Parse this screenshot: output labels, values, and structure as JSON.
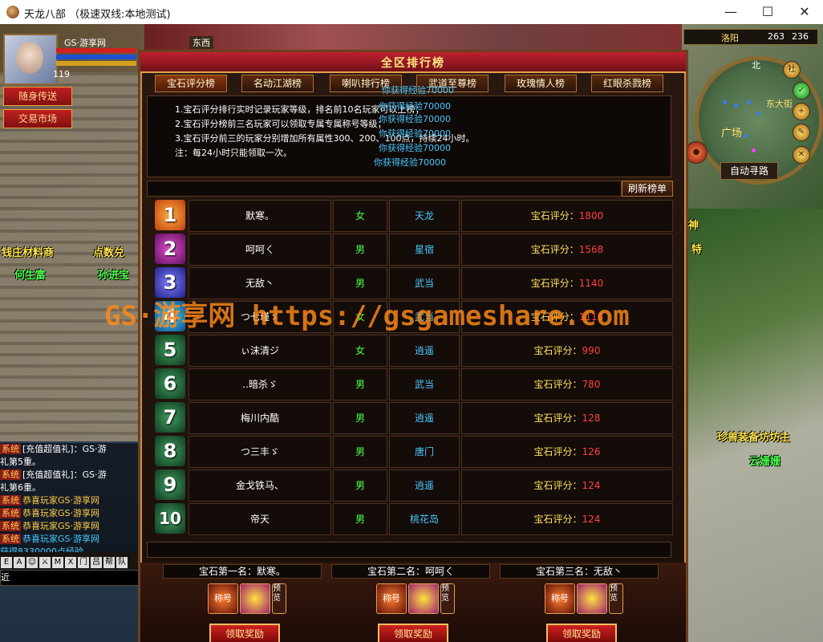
{
  "window": {
    "title": "天龙八部 （极速双线:本地测试)",
    "minimize": "—",
    "maximize": "☐",
    "close": "✕"
  },
  "character": {
    "level": "119",
    "name": "GS·游享网",
    "tab": "东西"
  },
  "quick_buttons": [
    "随身传送",
    "交易市场"
  ],
  "minimap": {
    "city": "洛阳",
    "x": "263",
    "y": "236",
    "direction": "北",
    "auto_path": "自动寻路",
    "labels": [
      "广场",
      "东大街"
    ]
  },
  "npc_labels": [
    "钱庄材料商",
    "点数兑",
    "何生富",
    "孙进宝",
    "珍兽装备坊坊主",
    "云姗姗",
    "神",
    "特"
  ],
  "panel": {
    "title": "全区排行榜",
    "tabs": [
      "宝石评分榜",
      "名动江湖榜",
      "喇叭排行榜",
      "武道至尊榜",
      "玫瑰情人榜",
      "红眼杀戮榜"
    ],
    "rules": [
      "1.宝石评分排行实时记录玩家等级，排名前10名玩家可以上榜；",
      "2.宝石评分榜前三名玩家可以领取专属专属称号等级；",
      "3.宝石评分前三的玩家分别增加所有属性300、200、100点，持续24小时。",
      "注：每24小时只能领取一次。"
    ],
    "exp_messages": [
      "你获得经验70000",
      "你获得经验70000",
      "你获得经验70000",
      "你获得经验70000",
      "你获得经验70000",
      "你获得经验70000"
    ],
    "refresh_label": "刷新榜单",
    "score_prefix": "宝石评分：",
    "rows": [
      {
        "rank": "1",
        "name": "默寒。",
        "sex": "女",
        "school": "天龙",
        "score": "1800"
      },
      {
        "rank": "2",
        "name": "呵呵ㄑ",
        "sex": "男",
        "school": "星宿",
        "score": "1568"
      },
      {
        "rank": "3",
        "name": "无敌丶",
        "sex": "男",
        "school": "武当",
        "score": "1140"
      },
      {
        "rank": "4",
        "name": "つ七瑾ゞ",
        "sex": "女",
        "school": "武当",
        "score": "1116"
      },
      {
        "rank": "5",
        "name": "ぃ沫清ジ",
        "sex": "女",
        "school": "逍遥",
        "score": "990"
      },
      {
        "rank": "6",
        "name": "‥暗杀ゞ",
        "sex": "男",
        "school": "武当",
        "score": "780"
      },
      {
        "rank": "7",
        "name": "梅川内酷",
        "sex": "男",
        "school": "逍遥",
        "score": "128"
      },
      {
        "rank": "8",
        "name": "つ三丰ゞ",
        "sex": "男",
        "school": "唐门",
        "score": "126"
      },
      {
        "rank": "9",
        "name": "金戈铁马、",
        "sex": "男",
        "school": "逍遥",
        "score": "124"
      },
      {
        "rank": "10",
        "name": "帝天",
        "sex": "男",
        "school": "桃花岛",
        "score": "124"
      }
    ],
    "rewards": [
      {
        "label": "宝石第一名：默寒。",
        "button": "领取奖励",
        "icon_text": "称号"
      },
      {
        "label": "宝石第二名：呵呵ㄑ",
        "button": "领取奖励",
        "icon_text": "称号"
      },
      {
        "label": "宝石第三名：无敌丶",
        "button": "领取奖励",
        "icon_text": "称号"
      }
    ],
    "preview": "预览"
  },
  "chat": {
    "lines": [
      {
        "tag": "系统",
        "text": "[充值超值礼]：GS·游"
      },
      {
        "tag": "",
        "text": "礼第5重。"
      },
      {
        "tag": "系统",
        "text": "[充值超值礼]：GS·游"
      },
      {
        "tag": "",
        "text": "礼第6重。"
      },
      {
        "tag": "系统",
        "text": "恭喜玩家GS·游享网"
      },
      {
        "tag": "系统",
        "text": "恭喜玩家GS·游享网"
      },
      {
        "tag": "系统",
        "text": "恭喜玩家GS·游享网"
      },
      {
        "tag": "系统",
        "text": "恭喜玩家GS·游享网"
      }
    ],
    "exp_gain": "获得8330000点经验",
    "input_prefix": "近",
    "tools": [
      "E",
      "A",
      "☺",
      "⚔",
      "M",
      "X",
      "门",
      "吕",
      "帮",
      "队"
    ]
  },
  "watermark": "GS·游享网 https://gsgameshare.com",
  "colors": {
    "panel_border": "#c89050",
    "title_red": "#c02030",
    "score_num": "#ff4040",
    "sex_green": "#4cff4c",
    "school_blue": "#4ac8ff"
  }
}
